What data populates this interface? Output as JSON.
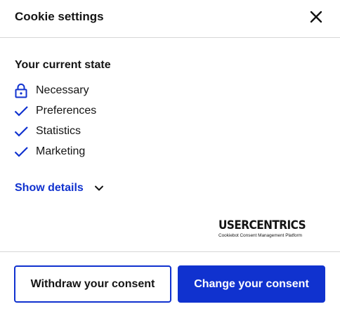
{
  "header": {
    "title": "Cookie settings",
    "close_icon": "close-icon"
  },
  "state": {
    "title": "Your current state",
    "items": [
      {
        "label": "Necessary",
        "icon": "lock-icon"
      },
      {
        "label": "Preferences",
        "icon": "checkmark-icon"
      },
      {
        "label": "Statistics",
        "icon": "checkmark-icon"
      },
      {
        "label": "Marketing",
        "icon": "checkmark-icon"
      }
    ]
  },
  "details": {
    "label": "Show details",
    "icon": "chevron-down-icon"
  },
  "brand": {
    "name": "USERCENTRICS",
    "tagline": "Cookiebot Consent Management Platform"
  },
  "footer": {
    "withdraw_label": "Withdraw your consent",
    "change_label": "Change your consent"
  },
  "colors": {
    "accent": "#1032cf",
    "text": "#141414",
    "divider": "#d6d6d6"
  }
}
